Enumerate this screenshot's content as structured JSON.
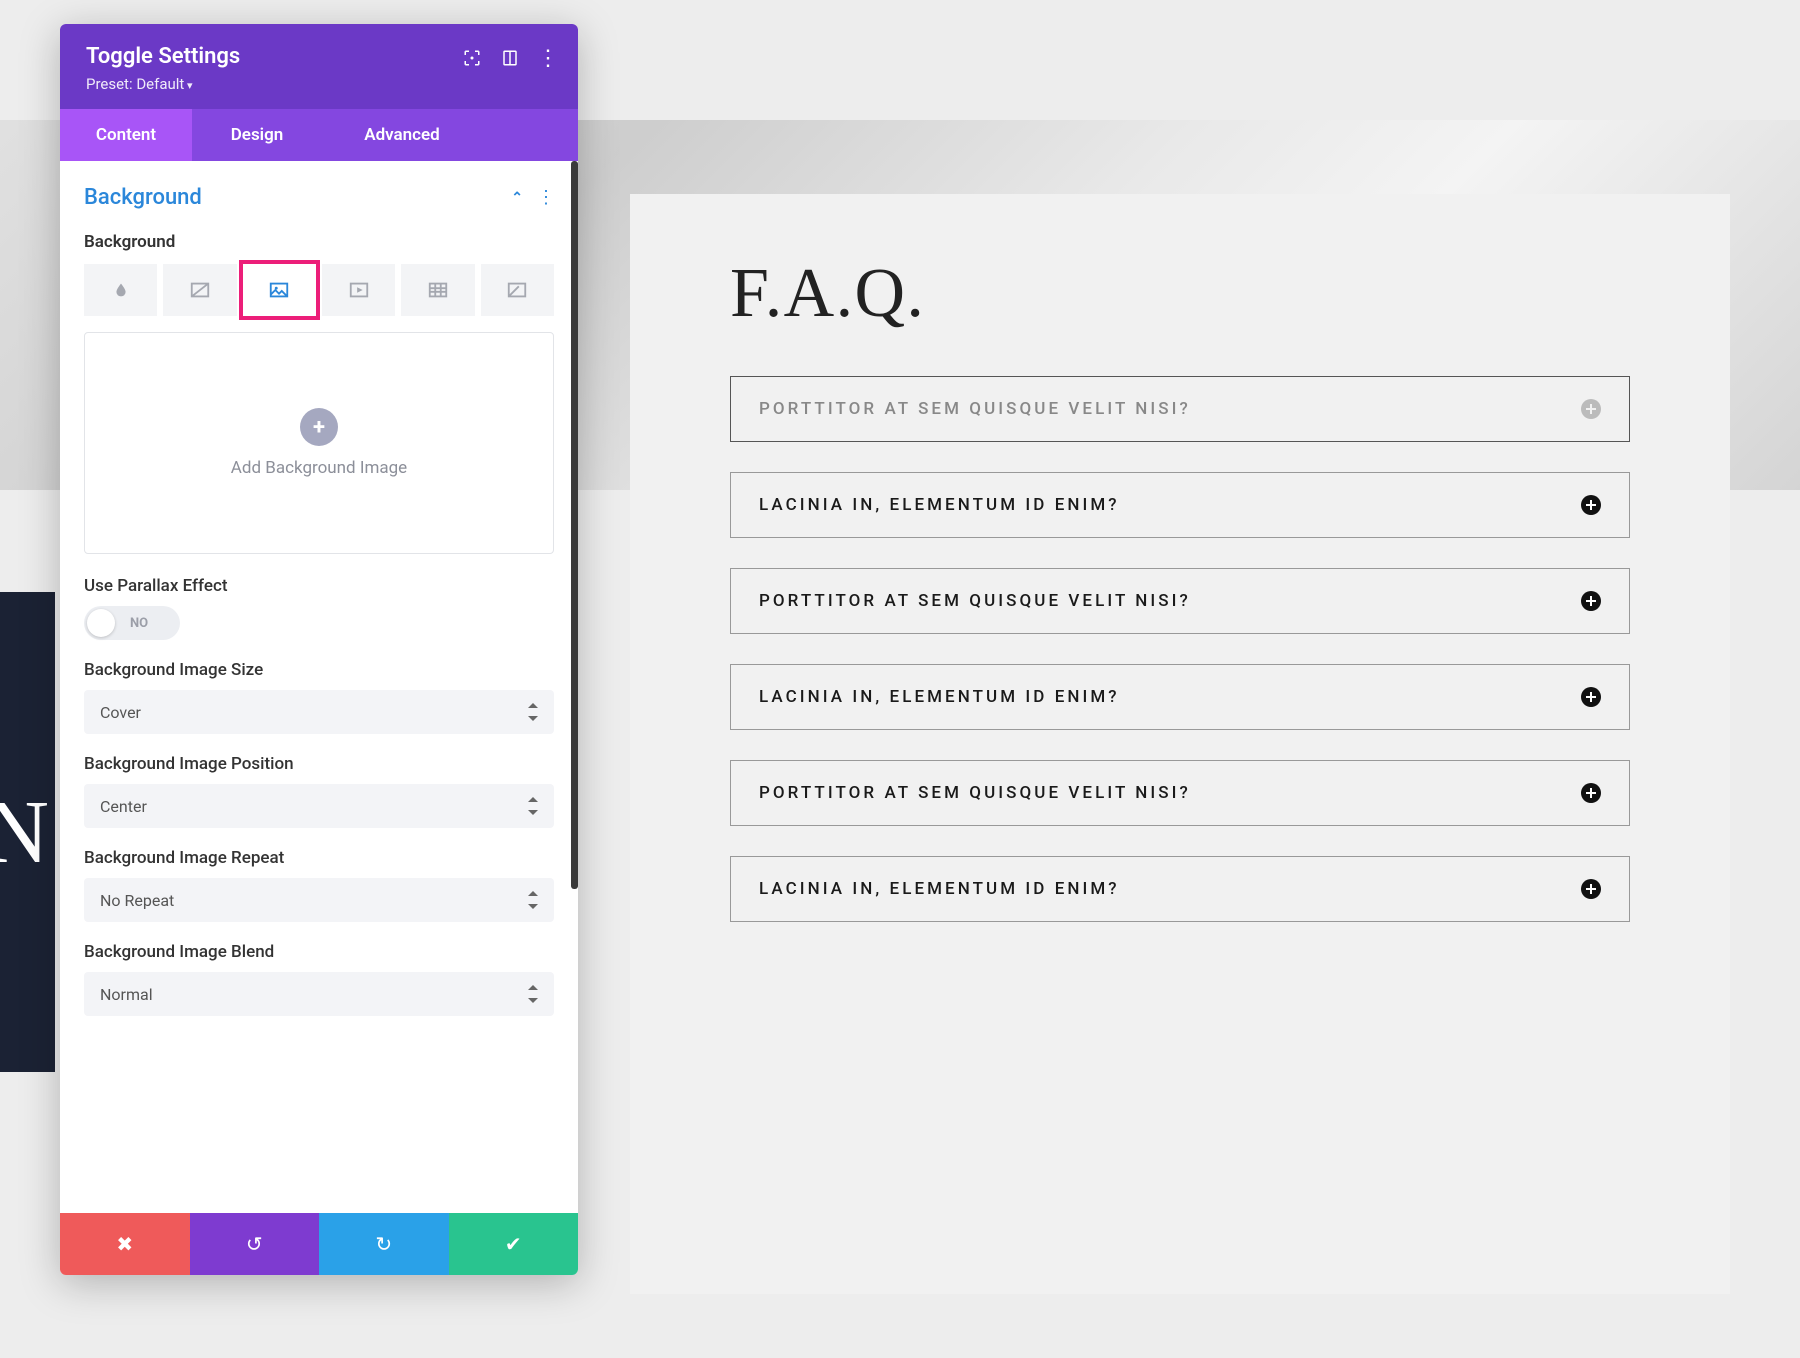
{
  "panel": {
    "title": "Toggle Settings",
    "preset": "Preset: Default",
    "tabs": {
      "content": "Content",
      "design": "Design",
      "advanced": "Advanced"
    },
    "section": {
      "title": "Background",
      "label": "Background"
    },
    "dropzone": {
      "label": "Add Background Image"
    },
    "parallax": {
      "label": "Use Parallax Effect",
      "value": "NO"
    },
    "size": {
      "label": "Background Image Size",
      "value": "Cover"
    },
    "position": {
      "label": "Background Image Position",
      "value": "Center"
    },
    "repeat": {
      "label": "Background Image Repeat",
      "value": "No Repeat"
    },
    "blend": {
      "label": "Background Image Blend",
      "value": "Normal"
    }
  },
  "preview": {
    "dark_letter": "N",
    "faq_title": "F.A.Q.",
    "items": [
      {
        "q": "PORTTITOR AT SEM QUISQUE VELIT NISI?",
        "active": true
      },
      {
        "q": "LACINIA IN, ELEMENTUM ID ENIM?",
        "active": false
      },
      {
        "q": "PORTTITOR AT SEM QUISQUE VELIT NISI?",
        "active": false
      },
      {
        "q": "LACINIA IN, ELEMENTUM ID ENIM?",
        "active": false
      },
      {
        "q": "PORTTITOR AT SEM QUISQUE VELIT NISI?",
        "active": false
      },
      {
        "q": "LACINIA IN, ELEMENTUM ID ENIM?",
        "active": false
      }
    ]
  }
}
